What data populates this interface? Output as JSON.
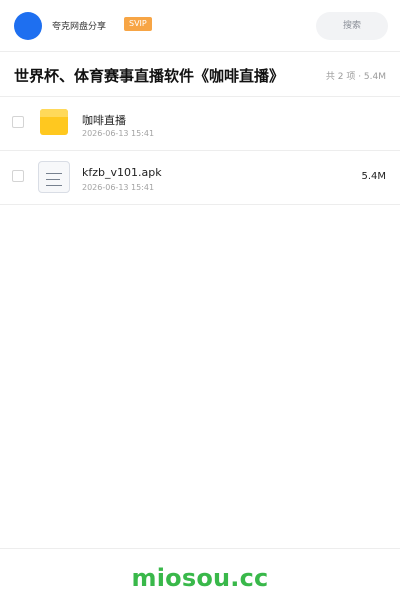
{
  "header": {
    "brand": "夸克网盘分享",
    "svip_badge": "SVIP",
    "search_placeholder": "搜索",
    "accent_color": "#1e6ff0"
  },
  "share": {
    "title": "世界杯、体育赛事直播软件《咖啡直播》",
    "summary": "共 2 项 · 5.4M"
  },
  "files": [
    {
      "name": "咖啡直播",
      "modified": "2026-06-13 15:41",
      "size": "",
      "icon": "folder-icon",
      "selected": false
    },
    {
      "name": "kfzb_v101.apk",
      "modified": "2026-06-13 15:41",
      "size": "5.4M",
      "icon": "document-icon",
      "selected": false
    }
  ],
  "footer": {
    "watermark": "miosou.cc",
    "watermark_color": "#39b84a"
  }
}
